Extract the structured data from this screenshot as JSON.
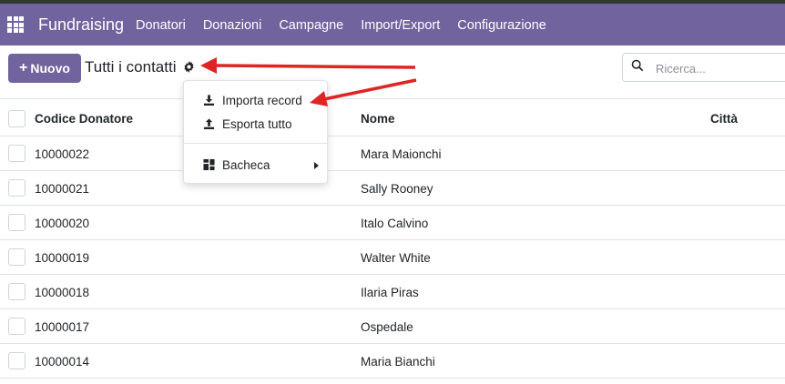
{
  "topbar": {
    "app_name": "Fundraising",
    "menu": [
      "Donatori",
      "Donazioni",
      "Campagne",
      "Import/Export",
      "Configurazione"
    ]
  },
  "controls": {
    "new_button": "Nuovo",
    "breadcrumb": "Tutti i contatti",
    "search_placeholder": "Ricerca..."
  },
  "dropdown": {
    "items": [
      {
        "label": "Importa record",
        "icon": "download-icon"
      },
      {
        "label": "Esporta tutto",
        "icon": "upload-icon"
      },
      {
        "label": "Bacheca",
        "icon": "dashboard-icon",
        "has_submenu": true
      }
    ]
  },
  "table": {
    "columns": [
      "Codice Donatore",
      "Nome",
      "Città"
    ],
    "rows": [
      {
        "code": "10000022",
        "name": "Mara Maionchi"
      },
      {
        "code": "10000021",
        "name": "Sally Rooney"
      },
      {
        "code": "10000020",
        "name": "Italo Calvino"
      },
      {
        "code": "10000019",
        "name": "Walter White"
      },
      {
        "code": "10000018",
        "name": "Ilaria Piras"
      },
      {
        "code": "10000017",
        "name": "Ospedale"
      },
      {
        "code": "10000014",
        "name": "Maria Bianchi"
      }
    ]
  },
  "colors": {
    "brand": "#71639e",
    "annotation_arrow": "#e02424"
  }
}
